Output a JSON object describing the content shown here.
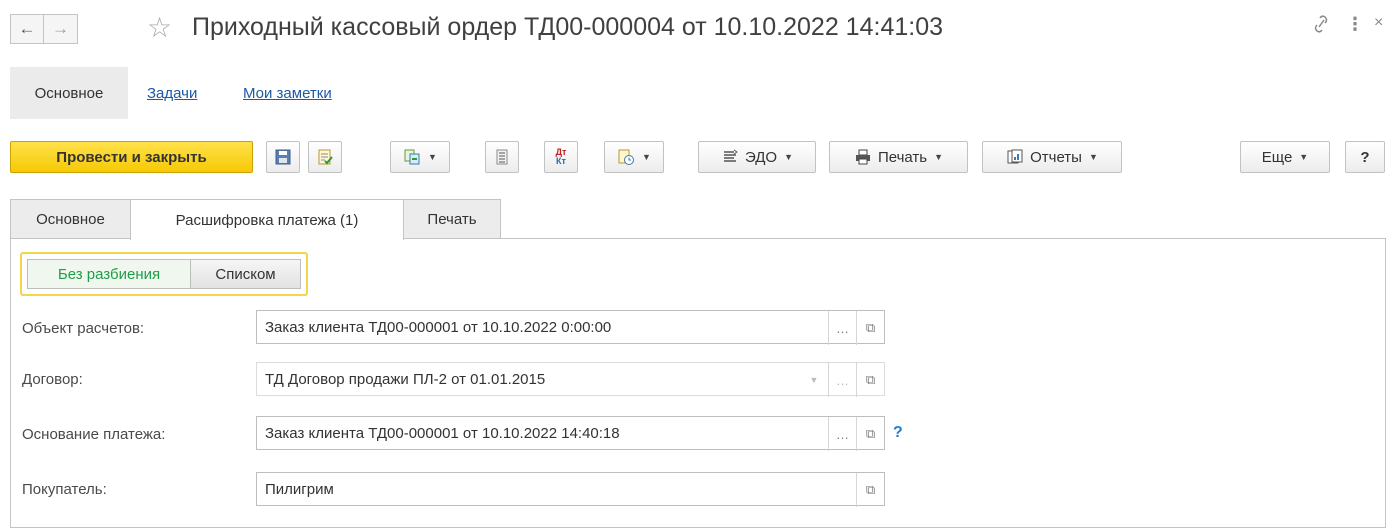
{
  "window": {
    "title": "Приходный кассовый ордер ТД00-000004 от 10.10.2022 14:41:03",
    "back_icon": "arrow-left-icon",
    "forward_icon": "arrow-right-icon",
    "star_icon": "star-icon",
    "link_icon": "link-icon",
    "more_icon": "more-vertical-icon",
    "close_icon": "close-icon"
  },
  "sections": {
    "active": "Основное",
    "links": [
      "Задачи",
      "Мои заметки"
    ]
  },
  "toolbar": {
    "post_close": "Провести и закрыть",
    "edo": "ЭДО",
    "print": "Печать",
    "reports": "Отчеты",
    "more": "Еще",
    "help": "?"
  },
  "tabs": [
    "Основное",
    "Расшифровка платежа (1)",
    "Печать"
  ],
  "toggle": {
    "option1": "Без разбиения",
    "option2": "Списком",
    "selected_color": "#1f9e4a"
  },
  "fields": {
    "object": {
      "label": "Объект расчетов:",
      "value": "Заказ клиента ТД00-000001 от 10.10.2022 0:00:00"
    },
    "contract": {
      "label": "Договор:",
      "value": "ТД Договор продажи ПЛ-2 от 01.01.2015"
    },
    "basis": {
      "label": "Основание платежа:",
      "value": "Заказ клиента ТД00-000001 от 10.10.2022 14:40:18",
      "help": "?"
    },
    "buyer": {
      "label": "Покупатель:",
      "value": "Пилигрим"
    }
  },
  "colors": {
    "primary_button": "#f6c905",
    "link": "#1c5aa3",
    "help": "#1c7fd0"
  }
}
